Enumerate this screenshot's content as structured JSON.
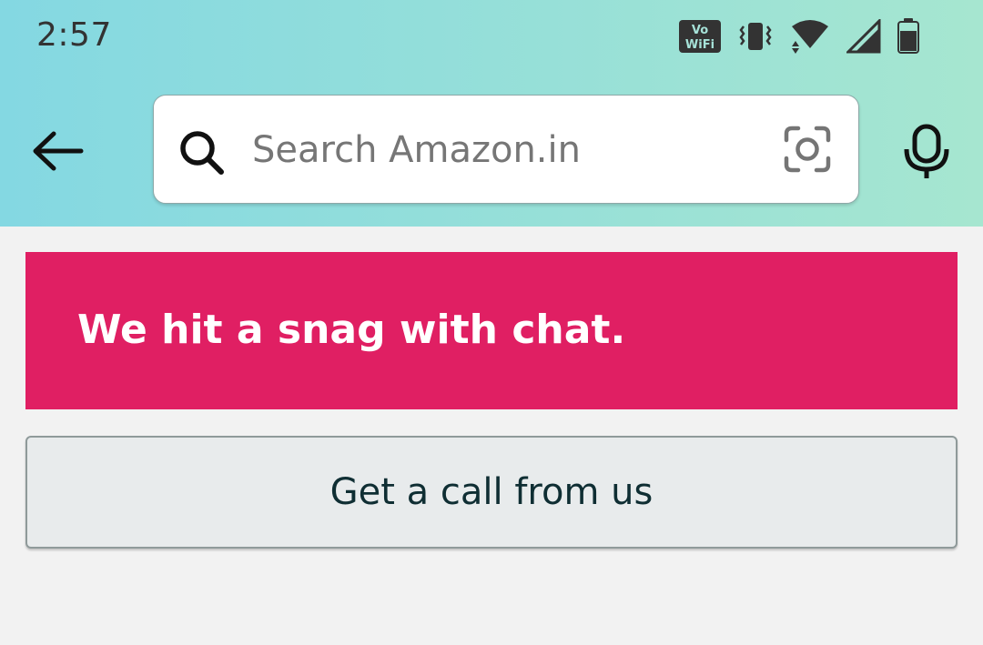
{
  "status_bar": {
    "time": "2:57",
    "vowifi_top": "Vo",
    "vowifi_bottom": "WiFi",
    "icons": [
      "vowifi-icon",
      "vibrate-icon",
      "wifi-icon",
      "cell-signal-icon",
      "battery-icon"
    ]
  },
  "header": {
    "search_placeholder": "Search Amazon.in",
    "icons": [
      "back-arrow-icon",
      "search-icon",
      "camera-lens-icon",
      "microphone-icon"
    ]
  },
  "error": {
    "message": "We hit a snag with chat."
  },
  "actions": {
    "call_label": "Get a call from us"
  },
  "colors": {
    "header_gradient_start": "#84d8e2",
    "header_gradient_end": "#a6e6d0",
    "error_banner": "#e01f63",
    "button_bg": "#e8ebec",
    "page_bg": "#f2f2f2"
  }
}
